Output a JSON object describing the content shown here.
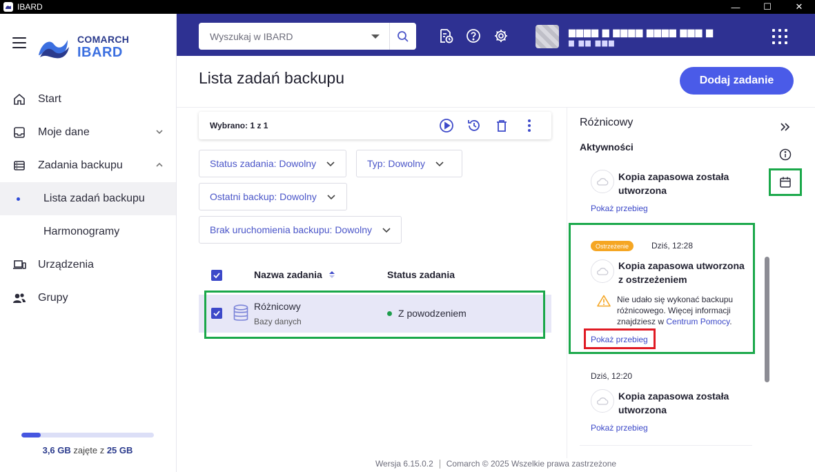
{
  "window": {
    "title": "IBARD",
    "controls": {
      "minimize": "—",
      "maximize": "☐",
      "close": "✕"
    }
  },
  "logo": {
    "brand": "COMARCH",
    "product": "IBARD"
  },
  "sidebar": {
    "items": [
      {
        "label": "Start",
        "icon": "home-icon"
      },
      {
        "label": "Moje dane",
        "icon": "inbox-icon",
        "expandable": true
      },
      {
        "label": "Zadania backupu",
        "icon": "list-icon",
        "expanded": true
      },
      {
        "label": "Lista zadań backupu",
        "sub": true,
        "active": true
      },
      {
        "label": "Harmonogramy",
        "sub": true
      },
      {
        "label": "Urządzenia",
        "icon": "devices-icon"
      },
      {
        "label": "Grupy",
        "icon": "group-icon"
      }
    ],
    "storage": {
      "used": "3,6 GB",
      "used_suffix": " zajęte z ",
      "total": "25 GB",
      "fraction": 0.144
    }
  },
  "header": {
    "search_placeholder": "Wyszukaj w IBARD",
    "user": {
      "name_blurred": "▆▆▆▆ ▆ ▆▆▆▆ ▆▆▆▆ ▆▆▆ ▆",
      "sub_blurred": "▆ ▆▆ ▆▆▆"
    }
  },
  "main": {
    "title": "Lista zadań backupu",
    "add_button": "Dodaj zadanie",
    "selection": "Wybrano: 1 z 1",
    "filters": {
      "status": "Status zadania: Dowolny",
      "type": "Typ: Dowolny",
      "last_backup": "Ostatni backup: Dowolny",
      "no_run": "Brak uruchomienia backupu: Dowolny"
    },
    "table": {
      "columns": {
        "name": "Nazwa zadania",
        "status": "Status zadania"
      },
      "rows": [
        {
          "name": "Różnicowy",
          "type": "Bazy danych",
          "status": "Z powodzeniem",
          "status_color": "#1e9d4c",
          "selected": true
        }
      ]
    }
  },
  "panel": {
    "title": "Różnicowy",
    "section": "Aktywności",
    "activities": [
      {
        "title": "Kopia zapasowa została utworzona",
        "link": "Pokaż przebieg"
      },
      {
        "badge": "Ostrzeżenie",
        "time": "Dziś, 12:28",
        "title": "Kopia zapasowa utworzona z ostrzeżeniem",
        "warning_text": "Nie udało się wykonać backupu różnicowego. Więcej informacji znajdziesz w ",
        "warning_link": "Centrum Pomocy",
        "warning_end": ".",
        "link": "Pokaż przebieg"
      },
      {
        "time": "Dziś, 12:20",
        "title": "Kopia zapasowa została utworzona",
        "link": "Pokaż przebieg"
      }
    ]
  },
  "footer": {
    "version": "Wersja 6.15.0.2",
    "copyright": "Comarch © 2025 Wszelkie prawa zastrzeżone"
  },
  "colors": {
    "accent": "#2e3192",
    "primary_button": "#4a5be8",
    "warning": "#f5a623",
    "success": "#1e9d4c",
    "highlight_green": "#1aa84a",
    "highlight_red": "#e01b24"
  }
}
